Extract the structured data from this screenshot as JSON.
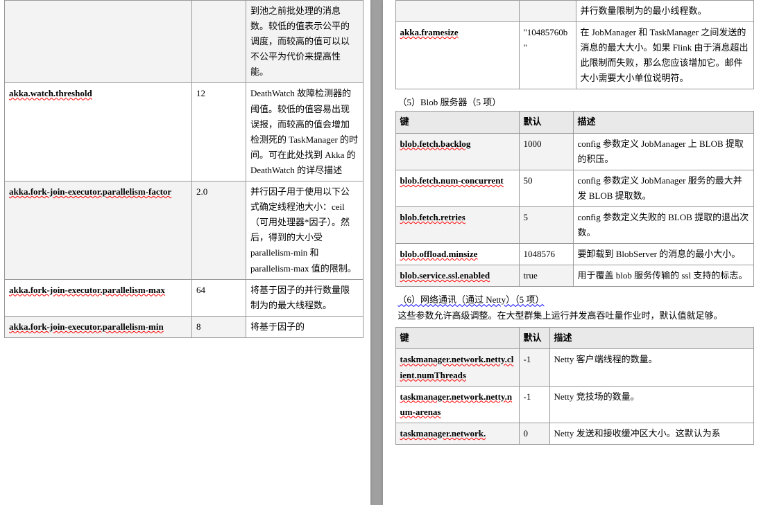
{
  "left": {
    "rows": [
      {
        "key": "",
        "val": "",
        "desc": "到池之前批处理的消息数。较低的值表示公平的调度，而较高的值可以以不公平为代价来提高性能。",
        "shade": true
      },
      {
        "key": "akka.watch.threshold",
        "val": "12",
        "desc": "DeathWatch 故障检测器的阈值。较低的值容易出现误报，而较高的值会增加检测死的 TaskManager 的时间。可在此处找到 Akka 的 DeathWatch 的详尽描述"
      },
      {
        "key": "akka.fork-join-executor.parallelism-factor",
        "val": "2.0",
        "desc": "并行因子用于使用以下公式确定线程池大小：ceil（可用处理器*因子）。然后，得到的大小受 parallelism-min 和 parallelism-max 值的限制。",
        "shade": true
      },
      {
        "key": "akka.fork-join-executor.parallelism-max",
        "val": "64",
        "desc": "将基于因子的并行数量限制为的最大线程数。"
      },
      {
        "key": "akka.fork-join-executor.parallelism-min",
        "val": "8",
        "desc": "将基于因子的",
        "shade": true
      }
    ]
  },
  "right": {
    "topRows": [
      {
        "key": "",
        "val": "",
        "desc": "并行数量限制为的最小线程数。",
        "shade": true
      },
      {
        "key": "akka.framesize",
        "val": "\"10485760b\"",
        "desc": "在 JobManager 和 TaskManager 之间发送的消息的最大大小。如果 Flink 由于消息超出此限制而失败，那么您应该增加它。邮件大小需要大小单位说明符。"
      }
    ],
    "sect5": "（5）Blob 服务器（5 项）",
    "hdr": {
      "k": "键",
      "v": "默认",
      "d": "描述"
    },
    "blobRows": [
      {
        "key": "blob.fetch.backlog",
        "val": "1000",
        "desc": "config 参数定义 JobManager 上 BLOB 提取的积压。",
        "shade": true
      },
      {
        "key": "blob.fetch.num-concurrent",
        "val": "50",
        "desc": "config 参数定义 JobManager 服务的最大并发 BLOB 提取数。"
      },
      {
        "key": "blob.fetch.retries",
        "val": "5",
        "desc": "config 参数定义失败的 BLOB 提取的退出次数。",
        "shade": true
      },
      {
        "key": "blob.offload.minsize",
        "val": "1048576",
        "desc": "要卸载到 BlobServer 的消息的最小大小。"
      },
      {
        "key": "blob.service.ssl.enabled",
        "val": "true",
        "desc": "用于覆盖 blob 服务传输的 ssl 支持的标志。",
        "shade": true
      }
    ],
    "sect6": "（6）网络通讯（通过 Netty）（5 项）",
    "note6": "这些参数允许高级调整。在大型群集上运行并发高吞吐量作业时，默认值就足够。",
    "netRows": [
      {
        "key": "taskmanager.network.netty.client.numThreads",
        "val": "-1",
        "desc": "Netty 客户端线程的数量。",
        "shade": true
      },
      {
        "key": "taskmanager.network.netty.num-arenas",
        "val": "-1",
        "desc": "Netty 竞技场的数量。"
      },
      {
        "key": "taskmanager.network.",
        "val": "0",
        "desc": "Netty 发送和接收缓冲区大小。这默认为系",
        "shade": true
      }
    ]
  }
}
